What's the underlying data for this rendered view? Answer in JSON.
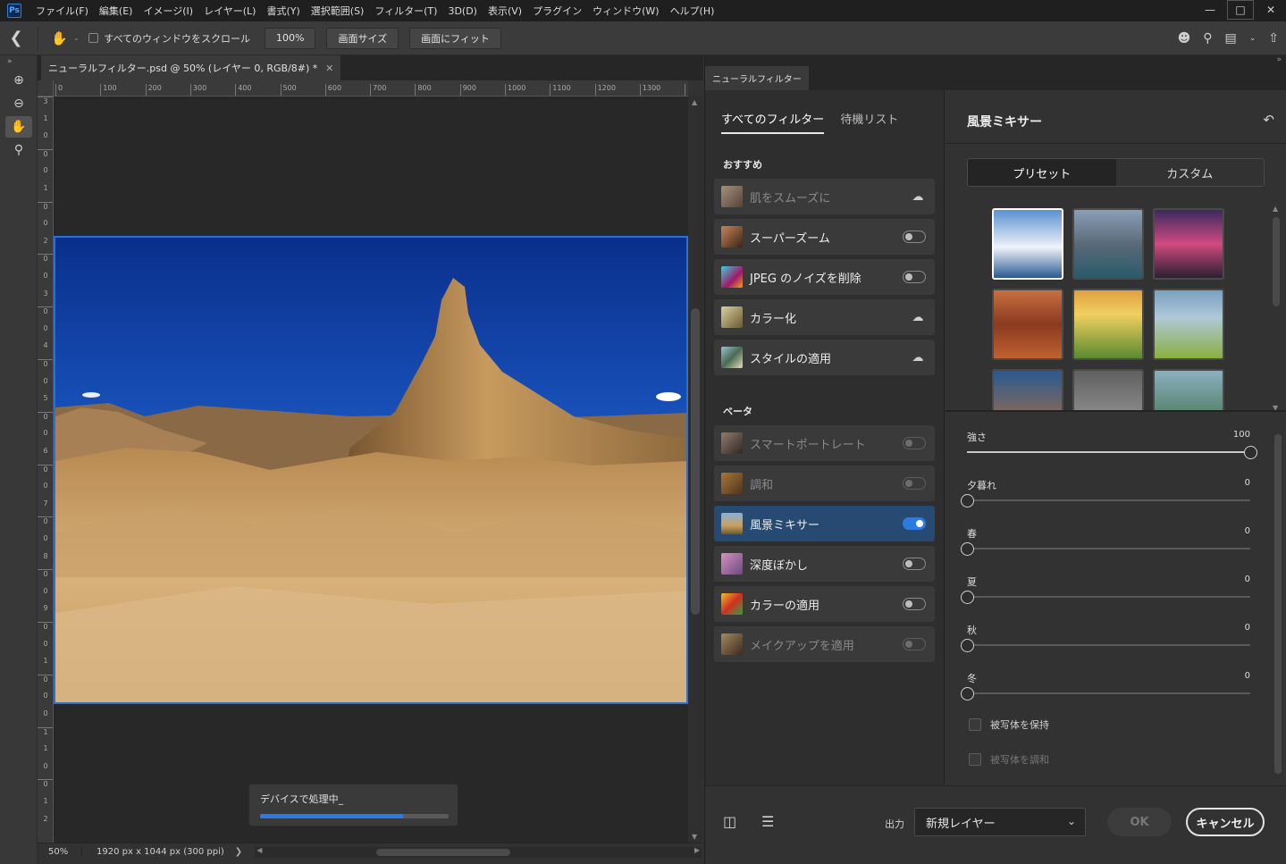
{
  "menubar": {
    "logo": "Ps",
    "items": [
      "ファイル(F)",
      "編集(E)",
      "イメージ(I)",
      "レイヤー(L)",
      "書式(Y)",
      "選択範囲(S)",
      "フィルター(T)",
      "3D(D)",
      "表示(V)",
      "プラグイン",
      "ウィンドウ(W)",
      "ヘルプ(H)"
    ]
  },
  "options": {
    "scroll_all_label": "すべてのウィンドウをスクロール",
    "zoom_value": "100%",
    "fit_screen_size": "画面サイズ",
    "fit_screen": "画面にフィット"
  },
  "document": {
    "tab_title": "ニューラルフィルター.psd @ 50% (レイヤー 0, RGB/8#) *",
    "ruler_h": [
      "0",
      "100",
      "200",
      "300",
      "400",
      "500",
      "600",
      "700",
      "800",
      "900",
      "1000",
      "1100",
      "1200",
      "1300",
      "14"
    ],
    "ruler_v": [
      "3",
      "1",
      "0",
      "0",
      "0",
      "1",
      "0",
      "0",
      "2",
      "0",
      "0",
      "3",
      "0",
      "0",
      "4",
      "0",
      "0",
      "5",
      "0",
      "0",
      "6",
      "0",
      "0",
      "7",
      "0",
      "0",
      "8",
      "0",
      "0",
      "9",
      "0",
      "0",
      "1",
      "0",
      "0",
      "0",
      "1",
      "1",
      "0",
      "0",
      "1",
      "2"
    ],
    "processing_label": "デバイスで処理中_",
    "processing_progress": 0.76,
    "status_zoom": "50%",
    "status_info": "1920 px x 1044 px (300 ppi)"
  },
  "neural": {
    "panel_tab": "ニューラルフィルター",
    "tabs": [
      "すべてのフィルター",
      "待機リスト"
    ],
    "section_recommended": "おすすめ",
    "section_beta": "ベータ",
    "recommended": [
      {
        "name": "肌をスムーズに",
        "control": "cloud",
        "disabled": true
      },
      {
        "name": "スーパーズーム",
        "control": "toggle",
        "on": false
      },
      {
        "name": "JPEG のノイズを削除",
        "control": "toggle",
        "on": false
      },
      {
        "name": "カラー化",
        "control": "cloud"
      },
      {
        "name": "スタイルの適用",
        "control": "cloud"
      }
    ],
    "beta": [
      {
        "name": "スマートポートレート",
        "control": "toggle",
        "on": false,
        "disabled": true
      },
      {
        "name": "調和",
        "control": "toggle",
        "on": false,
        "disabled": true
      },
      {
        "name": "風景ミキサー",
        "control": "toggle",
        "on": true,
        "active": true
      },
      {
        "name": "深度ぼかし",
        "control": "toggle",
        "on": false
      },
      {
        "name": "カラーの適用",
        "control": "toggle",
        "on": false
      },
      {
        "name": "メイクアップを適用",
        "control": "toggle",
        "on": false,
        "disabled": true
      }
    ],
    "settings_title": "風景ミキサー",
    "segment": [
      "プリセット",
      "カスタム"
    ],
    "sliders": [
      {
        "label": "強さ",
        "value": 100
      },
      {
        "label": "夕暮れ",
        "value": 0
      },
      {
        "label": "春",
        "value": 0
      },
      {
        "label": "夏",
        "value": 0
      },
      {
        "label": "秋",
        "value": 0
      },
      {
        "label": "冬",
        "value": 0
      }
    ],
    "checkbox_keep_subject": "被写体を保持",
    "checkbox_harmonize_subject": "被写体を調和",
    "output_label": "出力",
    "output_value": "新規レイヤー",
    "ok_label": "OK",
    "cancel_label": "キャンセル"
  },
  "colors": {
    "accent": "#2f7ae0",
    "active_filter_bg": "#274a73"
  }
}
